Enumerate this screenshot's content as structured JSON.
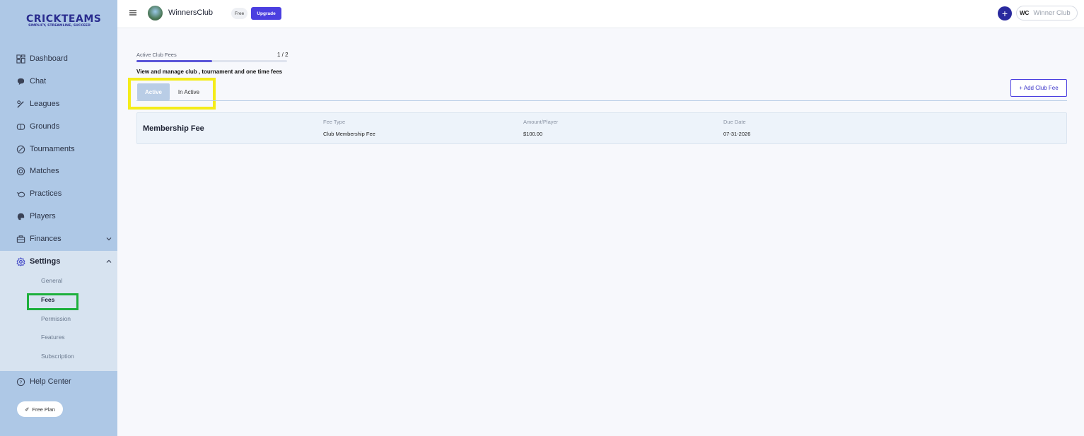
{
  "brand": {
    "name": "CRICKTEAMS",
    "tagline": "SIMPLIFY, STREAMLINE, SUCCEED"
  },
  "sidebar": {
    "items": [
      {
        "label": "Dashboard",
        "icon": "dashboard-icon"
      },
      {
        "label": "Chat",
        "icon": "chat-icon"
      },
      {
        "label": "Leagues",
        "icon": "leagues-icon"
      },
      {
        "label": "Grounds",
        "icon": "grounds-icon"
      },
      {
        "label": "Tournaments",
        "icon": "tournaments-icon"
      },
      {
        "label": "Matches",
        "icon": "matches-icon"
      },
      {
        "label": "Practices",
        "icon": "practices-icon"
      },
      {
        "label": "Players",
        "icon": "players-icon"
      },
      {
        "label": "Finances",
        "icon": "finances-icon"
      },
      {
        "label": "Settings",
        "icon": "gear-icon"
      },
      {
        "label": "Help Center",
        "icon": "help-icon"
      }
    ],
    "settings_sub": [
      "General",
      "Fees",
      "Permission",
      "Features",
      "Subscription"
    ],
    "active_sub": "Fees",
    "free_plan": "Free Plan"
  },
  "topbar": {
    "club_name": "WinnersClub",
    "plan_badge": "Free",
    "upgrade_label": "Upgrade",
    "add_label": "+",
    "user_initials": "WC",
    "user_name": "Winner Club"
  },
  "main": {
    "progress_label": "Active Club Fees",
    "progress_count": "1 / 2",
    "progress_fraction": 0.5,
    "subtitle": "View and manage club , tournament and one time fees",
    "tabs": [
      {
        "label": "Active",
        "active": true
      },
      {
        "label": "In Active",
        "active": false
      }
    ],
    "add_button": "+ Add Club Fee",
    "fees": [
      {
        "name": "Membership Fee",
        "fee_type_label": "Fee Type",
        "fee_type": "Club Membership Fee",
        "amount_label": "Amount/Player",
        "amount": "$100.00",
        "due_label": "Due Date",
        "due_date": "07-31-2026"
      }
    ]
  },
  "colors": {
    "sidebar_bg": "#aec8e6",
    "accent": "#4b3fe0",
    "highlight_tabs": "#f4ec1a",
    "highlight_fees": "#1db03c"
  }
}
